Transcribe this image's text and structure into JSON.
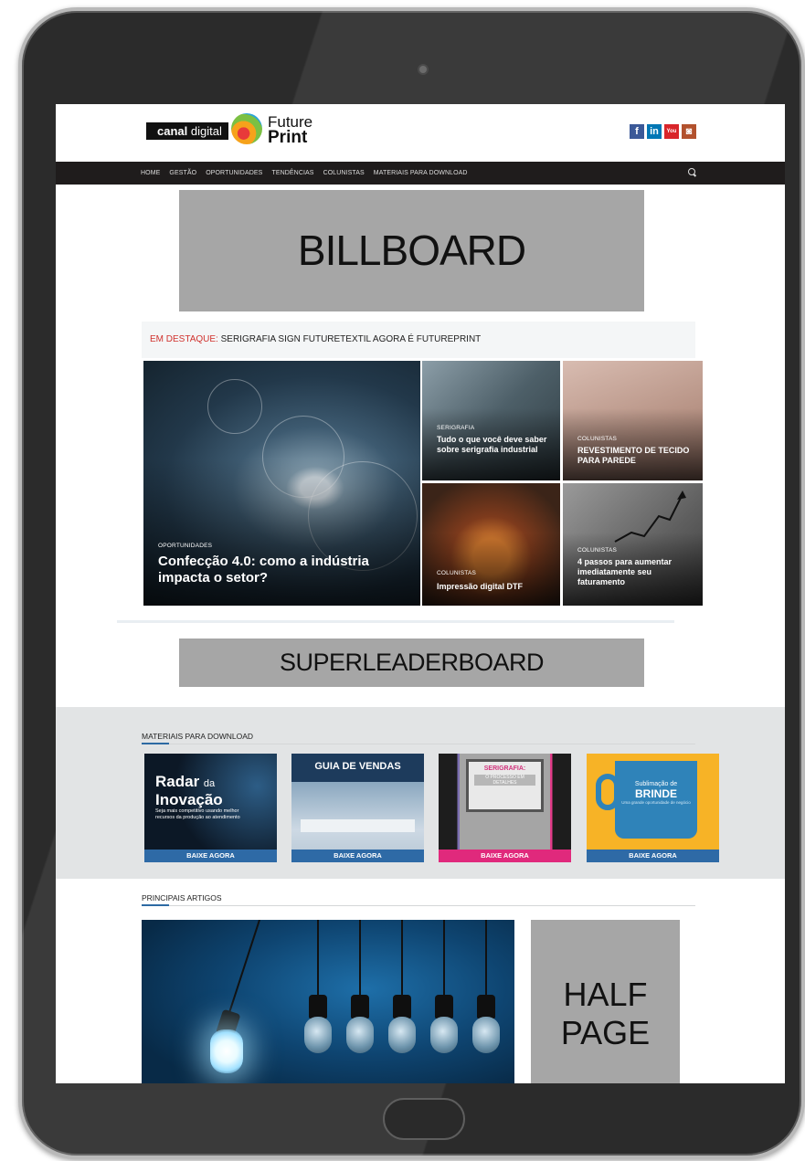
{
  "site": {
    "logo_brand": "canal",
    "logo_brand_suffix": "digital",
    "logo_future": "Future",
    "logo_print": "Print",
    "social": [
      "f",
      "in",
      "You Tube",
      "◙"
    ]
  },
  "nav": {
    "items": [
      "HOME",
      "GESTÃO",
      "OPORTUNIDADES",
      "TENDÊNCIAS",
      "COLUNISTAS",
      "MATERIAIS PARA DOWNLOAD"
    ]
  },
  "ads": {
    "billboard": "BILLBOARD",
    "superleaderboard": "SUPERLEADERBOARD",
    "half_page_line1": "HALF",
    "half_page_line2": "PAGE"
  },
  "highlight": {
    "label": "EM DESTAQUE:",
    "text": "SERIGRAFIA SIGN FUTURETEXTIL AGORA É FUTUREPRINT"
  },
  "featured": [
    {
      "category": "OPORTUNIDADES",
      "title": "Confecção 4.0: como a indústria impacta o setor?"
    },
    {
      "category": "SERIGRAFIA",
      "title": "Tudo o que você deve saber sobre serigrafia industrial"
    },
    {
      "category": "COLUNISTAS",
      "title": "REVESTIMENTO DE TECIDO PARA PAREDE"
    },
    {
      "category": "COLUNISTAS",
      "title": "Impressão digital DTF"
    },
    {
      "category": "COLUNISTAS",
      "title": "4 passos para aumentar imediatamente seu faturamento"
    }
  ],
  "downloads": {
    "title": "MATERIAIS PARA DOWNLOAD",
    "button_label": "BAIXE AGORA",
    "cards": [
      {
        "line1": "Radar",
        "line1_small": "da",
        "line2": "Inovação",
        "sub": "Seja mais competitivo usando melhor recursos da produção ao atendimento"
      },
      {
        "header": "GUIA DE VENDAS"
      },
      {
        "line1": "SERIGRAFIA:",
        "line2": "O PROCESSO EM DETALHES"
      },
      {
        "line1": "Sublimação de",
        "line2": "BRINDE",
        "sub": "Uma grande oportunidade de negócio"
      }
    ]
  },
  "articles": {
    "title": "PRINCIPAIS ARTIGOS"
  }
}
